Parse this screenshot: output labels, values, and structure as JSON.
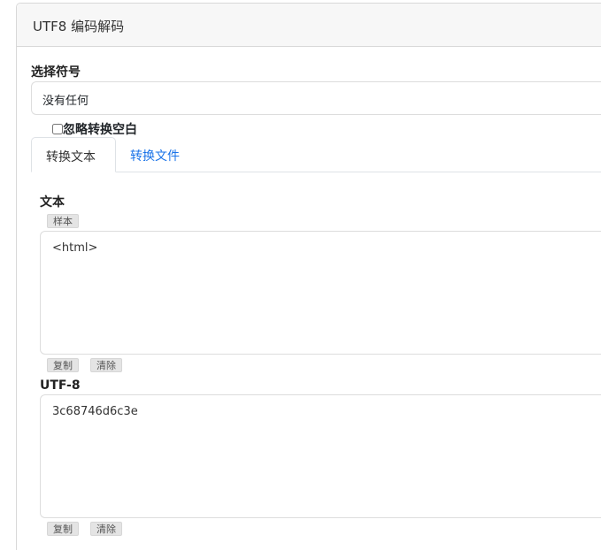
{
  "card": {
    "title": "UTF8 编码解码"
  },
  "symbol": {
    "label": "选择符号",
    "selected": "没有任何"
  },
  "ignore_whitespace": {
    "label": "忽略转换空白",
    "checked": false
  },
  "tabs": [
    {
      "label": "转换文本",
      "active": true
    },
    {
      "label": "转换文件",
      "active": false
    }
  ],
  "text_section": {
    "label": "文本",
    "sample_button": "样本",
    "value": "<html>",
    "copy_button": "复制",
    "clear_button": "清除"
  },
  "utf8_section": {
    "label": "UTF-8",
    "value": "3c68746d6c3e",
    "copy_button": "复制",
    "clear_button": "清除"
  }
}
